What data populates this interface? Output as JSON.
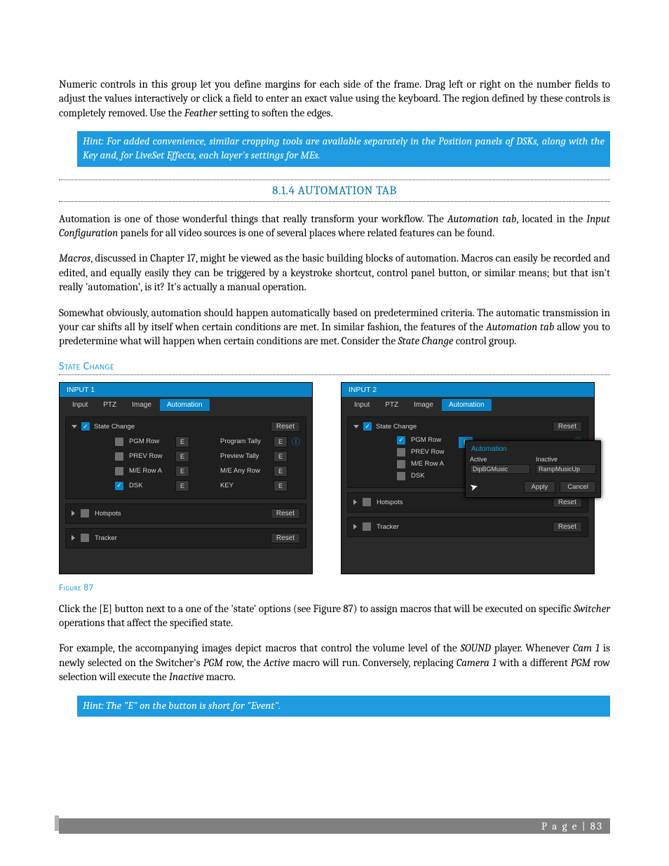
{
  "para1_a": "Numeric controls in this group let you define margins for each side of the frame.  Drag left or right on the number fields to adjust the values interactively or click a field to enter an exact value using the keyboard.  The region defined by these controls is completely removed.  Use the ",
  "para1_b": "Feather",
  "para1_c": " setting to soften the edges.",
  "hint1": "Hint: For added convenience, similar cropping tools are available separately in the Position panels of DSKs, along with the Key and, for LiveSet Effects, each layer's settings for MEs.",
  "section_num": "8.1.4 ",
  "section_title": "AUTOMATION TAB",
  "para2_a": "Automation is one of those wonderful things that really transform your workflow.  The ",
  "para2_b": "Automation tab",
  "para2_c": ", located in the ",
  "para2_d": "Input Configuration",
  "para2_e": " panels for all video sources is one of several places where related features can be found.",
  "para3_a": "Macros",
  "para3_b": ", discussed in Chapter 17, might be viewed as the basic building blocks of automation. Macros can easily be recorded and edited, and equally easily they can be triggered by a keystroke shortcut, control panel button, or similar means; but that isn't really 'automation', is it?  It's actually a manual operation.",
  "para4_a": "Somewhat obviously, automation should happen automatically based on predetermined criteria. The automatic transmission in your car shifts all by itself when certain conditions are met.  In similar fashion, the features of the ",
  "para4_b": "Automation tab",
  "para4_c": " allow you to predetermine what will happen when certain conditions are met. Consider the ",
  "para4_d": "State Change",
  "para4_e": " control group.",
  "subhead": "State Change",
  "fig_caption": "Figure 87",
  "para5_a": "Click the [E] button next to a one of the 'state' options (see Figure 87) to assign macros that will be executed on specific ",
  "para5_b": "Switcher",
  "para5_c": " operations that affect the specified state.",
  "para6_a": "For example, the accompanying images depict macros that control the volume level of the ",
  "para6_b": "SOUND",
  "para6_c": " player.  Whenever ",
  "para6_d": "Cam 1",
  "para6_e": " is newly selected on the Switcher's ",
  "para6_f": "PGM",
  "para6_g": " row, the ",
  "para6_h": "Active",
  "para6_i": " macro will run.  Conversely, replacing ",
  "para6_j": "Camera 1",
  "para6_k": " with a different ",
  "para6_l": "PGM",
  "para6_m": " row selection will execute the ",
  "para6_n": "Inactive",
  "para6_o": " macro.",
  "hint2": "Hint: The \"E\" on the button is short for \"Event\".",
  "footer": "P a g e  | 83",
  "panel1": {
    "title": "INPUT 1",
    "tabs": [
      "Input",
      "PTZ",
      "Image",
      "Automation"
    ],
    "active_tab": 3,
    "group_title": "State Change",
    "reset": "Reset",
    "rows_left": [
      "PGM Row",
      "PREV Row",
      "M/E Row A",
      "DSK"
    ],
    "rows_right": [
      "Program Tally",
      "Preview Tally",
      "M/E Any Row",
      "KEY"
    ],
    "checks_left": [
      false,
      false,
      false,
      true
    ],
    "e": "E",
    "collapsed": [
      {
        "label": "Hotspots",
        "reset": "Reset"
      },
      {
        "label": "Tracker",
        "reset": "Reset"
      }
    ]
  },
  "panel2": {
    "title": "INPUT 2",
    "tabs": [
      "Input",
      "PTZ",
      "Image",
      "Automation"
    ],
    "active_tab": 3,
    "group_title": "State Change",
    "reset": "Reset",
    "rows_left": [
      "PGM Row",
      "PREV Row",
      "M/E Row A",
      "DSK"
    ],
    "checks_left": [
      true,
      false,
      false,
      false
    ],
    "collapsed": [
      {
        "label": "Hotspots",
        "reset": "Reset"
      },
      {
        "label": "Tracker",
        "reset": "Reset"
      }
    ],
    "popup": {
      "header": "Automation",
      "active": "Active",
      "inactive": "Inactive",
      "active_val": "DipBGMusic",
      "inactive_val": "RampMusicUp",
      "apply": "Apply",
      "cancel": "Cancel",
      "e": "E"
    }
  }
}
